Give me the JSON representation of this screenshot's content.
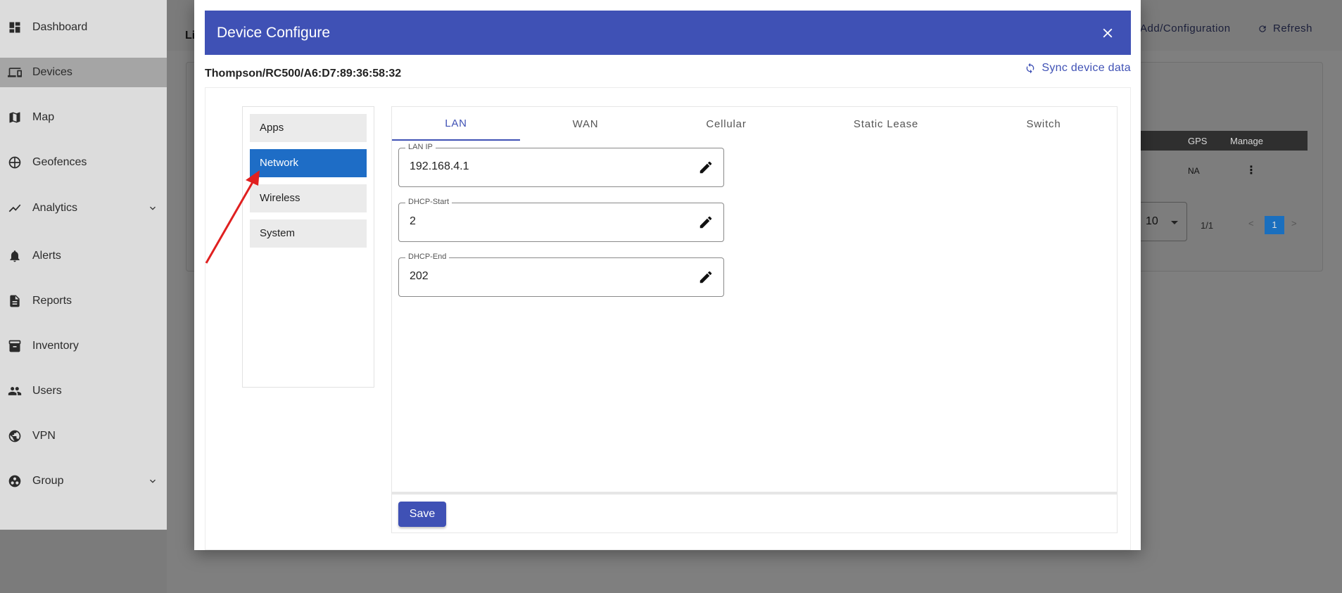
{
  "sidebar": {
    "items": [
      {
        "label": "Dashboard",
        "icon": "dashboard-icon"
      },
      {
        "label": "Devices",
        "icon": "devices-icon"
      },
      {
        "label": "Map",
        "icon": "map-icon"
      },
      {
        "label": "Geofences",
        "icon": "geofence-icon"
      },
      {
        "label": "Analytics",
        "icon": "analytics-icon"
      },
      {
        "label": "Alerts",
        "icon": "bell-icon"
      },
      {
        "label": "Reports",
        "icon": "report-icon"
      },
      {
        "label": "Inventory",
        "icon": "inventory-icon"
      },
      {
        "label": "Users",
        "icon": "users-icon"
      },
      {
        "label": "VPN",
        "icon": "vpn-icon"
      },
      {
        "label": "Group",
        "icon": "group-icon"
      }
    ],
    "active": "Devices"
  },
  "background": {
    "list_title_fragment": "Li",
    "actions": {
      "add_configuration": "Add/Configuration",
      "refresh": "Refresh"
    },
    "table": {
      "headers": [
        "GPS",
        "Manage"
      ],
      "row": {
        "gps": "NA"
      }
    },
    "rows_per_page": "10",
    "page_count": "1/1",
    "current_page": "1"
  },
  "modal": {
    "title": "Device Configure",
    "device_path": "Thompson/RC500/A6:D7:89:36:58:32",
    "sync_label": "Sync device data",
    "menu": [
      "Apps",
      "Network",
      "Wireless",
      "System"
    ],
    "active_menu": "Network",
    "tabs": [
      "LAN",
      "WAN",
      "Cellular",
      "Static Lease",
      "Switch"
    ],
    "active_tab": "LAN",
    "fields": [
      {
        "label": "LAN IP",
        "value": "192.168.4.1"
      },
      {
        "label": "DHCP-Start",
        "value": "2"
      },
      {
        "label": "DHCP-End",
        "value": "202"
      }
    ],
    "save_label": "Save"
  },
  "colors": {
    "primary": "#3f51b5",
    "active_menu": "#1e6dc6",
    "annotation_arrow": "#e02020"
  }
}
